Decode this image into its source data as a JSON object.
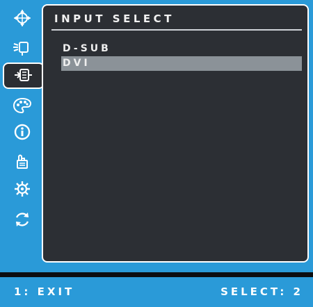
{
  "menu": {
    "title": "INPUT SELECT",
    "options": [
      {
        "label": "D-SUB",
        "selected": false
      },
      {
        "label": "DVI",
        "selected": true
      }
    ]
  },
  "sidebar": {
    "icons": [
      {
        "name": "auto-adjust-icon",
        "active": false
      },
      {
        "name": "contrast-brightness-icon",
        "active": false
      },
      {
        "name": "input-select-icon",
        "active": true
      },
      {
        "name": "color-adjust-icon",
        "active": false
      },
      {
        "name": "information-icon",
        "active": false
      },
      {
        "name": "manual-image-adjust-icon",
        "active": false
      },
      {
        "name": "setup-menu-icon",
        "active": false
      },
      {
        "name": "memory-recall-icon",
        "active": false
      }
    ]
  },
  "footer": {
    "exit_label": "1: EXIT",
    "select_label": "SELECT: 2"
  },
  "colors": {
    "frame_blue": "#2a9ad8",
    "panel_bg": "#2c2f34",
    "highlight": "#8b9298"
  }
}
